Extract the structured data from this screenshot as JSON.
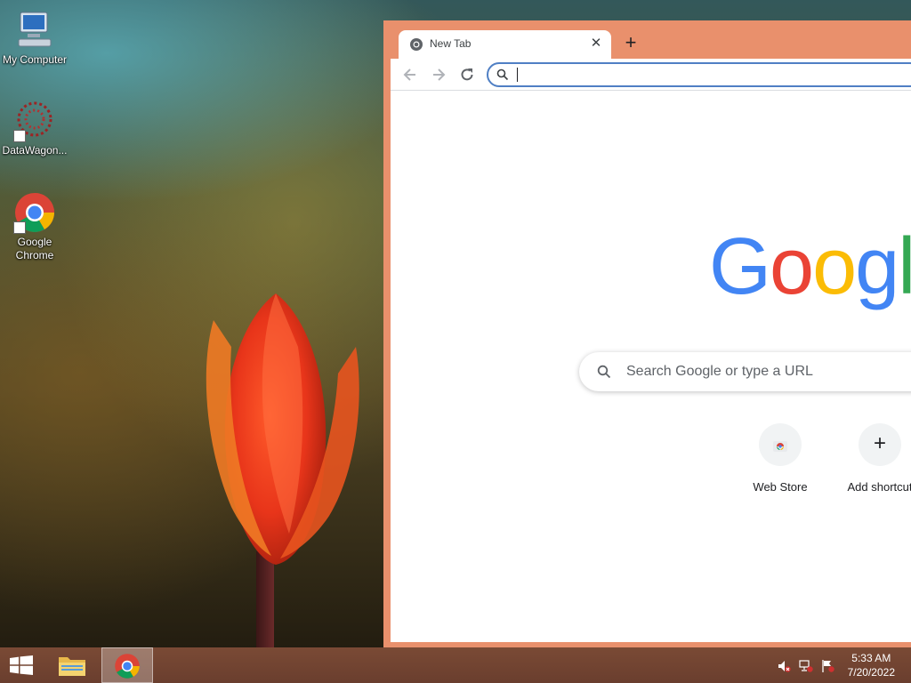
{
  "desktop": {
    "icons": [
      {
        "label": "My Computer"
      },
      {
        "label": "DataWagon..."
      },
      {
        "label": "Google\nChrome"
      }
    ]
  },
  "browser": {
    "tab": {
      "title": "New Tab",
      "close": "✕"
    },
    "new_tab": "+",
    "omnibox": {
      "value": ""
    },
    "page": {
      "logo_letters": [
        "G",
        "o",
        "o",
        "g",
        "l"
      ],
      "search_placeholder": "Search Google or type a URL",
      "shortcuts": [
        {
          "label": "Web Store"
        },
        {
          "label": "Add shortcut"
        }
      ],
      "add_symbol": "+"
    }
  },
  "taskbar": {
    "time": "5:33 AM",
    "date": "7/20/2022"
  },
  "colors": {
    "chrome_frame": "#e9906c",
    "taskbar": "#6a3e2e",
    "google_blue": "#4285f4",
    "google_red": "#ea4335",
    "google_yellow": "#fbbc05",
    "google_green": "#34a853"
  }
}
